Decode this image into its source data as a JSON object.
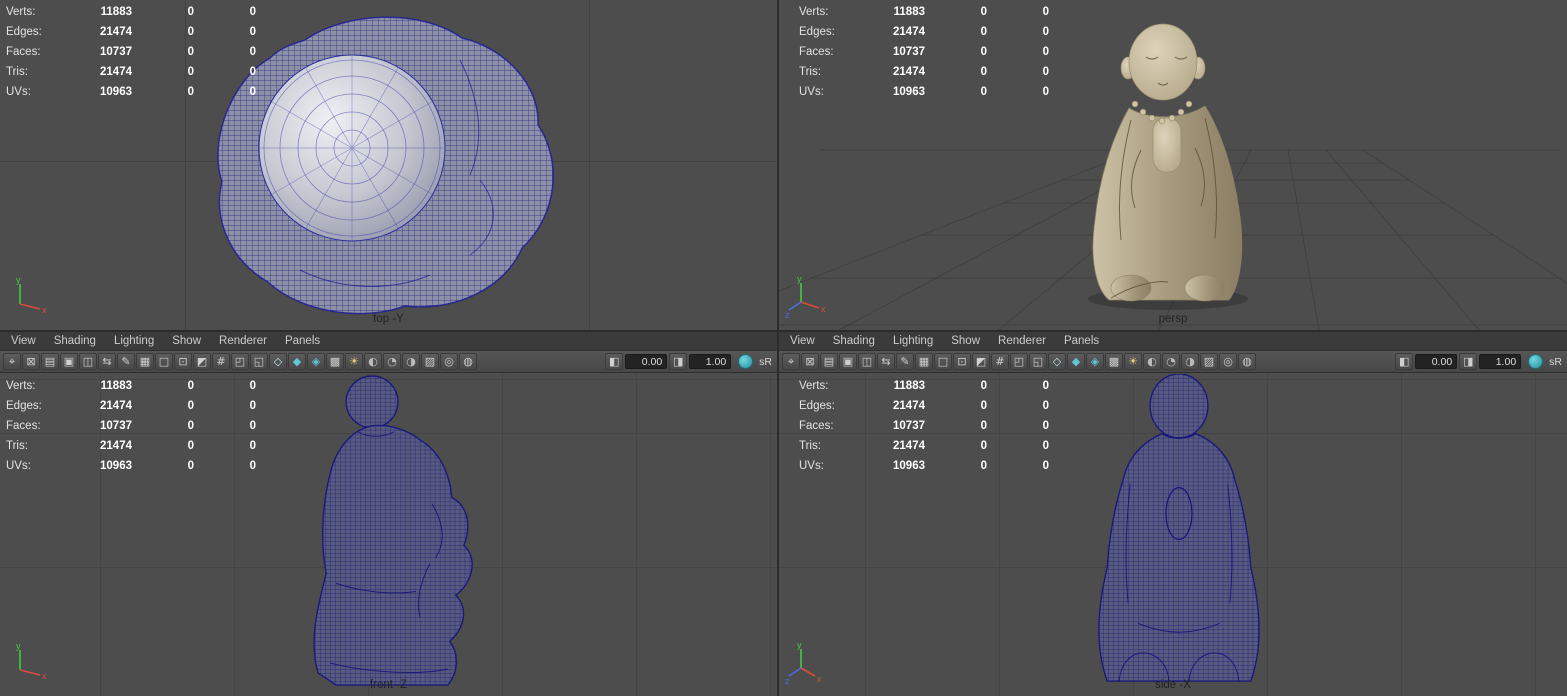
{
  "stats": {
    "rows": [
      {
        "label": "Verts:",
        "v1": "11883",
        "v2": "0",
        "v3": "0"
      },
      {
        "label": "Edges:",
        "v1": "21474",
        "v2": "0",
        "v3": "0"
      },
      {
        "label": "Faces:",
        "v1": "10737",
        "v2": "0",
        "v3": "0"
      },
      {
        "label": "Tris:",
        "v1": "21474",
        "v2": "0",
        "v3": "0"
      },
      {
        "label": "UVs:",
        "v1": "10963",
        "v2": "0",
        "v3": "0"
      }
    ]
  },
  "menus": [
    {
      "name": "menu-view",
      "label": "View"
    },
    {
      "name": "menu-shading",
      "label": "Shading"
    },
    {
      "name": "menu-lighting",
      "label": "Lighting"
    },
    {
      "name": "menu-show",
      "label": "Show"
    },
    {
      "name": "menu-renderer",
      "label": "Renderer"
    },
    {
      "name": "menu-panels",
      "label": "Panels"
    }
  ],
  "toolbar": {
    "icons": [
      {
        "name": "select-camera-icon",
        "glyph": "⌖",
        "color": "#d4d4d4"
      },
      {
        "name": "lock-camera-icon",
        "glyph": "⊠",
        "color": "#cfcfcf"
      },
      {
        "name": "camera-attributes-icon",
        "glyph": "▤",
        "color": "#cfcfcf"
      },
      {
        "name": "bookmarks-icon",
        "glyph": "▣",
        "color": "#cfcfcf"
      },
      {
        "name": "image-plane-icon",
        "glyph": "◫",
        "color": "#cfcfcf"
      },
      {
        "name": "pan-zoom-icon",
        "glyph": "⇆",
        "color": "#cfcfcf"
      },
      {
        "name": "grease-pencil-icon",
        "glyph": "✎",
        "color": "#cfcfcf"
      },
      {
        "name": "grid-icon",
        "glyph": "▦",
        "color": "#cfcfcf"
      },
      {
        "name": "film-gate-icon",
        "glyph": "□",
        "color": "#cfcfcf"
      },
      {
        "name": "resolution-gate-icon",
        "glyph": "⊡",
        "color": "#cfcfcf"
      },
      {
        "name": "gate-mask-icon",
        "glyph": "◩",
        "color": "#cfcfcf"
      },
      {
        "name": "field-chart-icon",
        "glyph": "#",
        "color": "#cfcfcf"
      },
      {
        "name": "safe-action-icon",
        "glyph": "◰",
        "color": "#cfcfcf"
      },
      {
        "name": "safe-title-icon",
        "glyph": "◱",
        "color": "#cfcfcf"
      },
      {
        "name": "wireframe-mode-icon",
        "glyph": "◇",
        "color": "#bfe3ee"
      },
      {
        "name": "shaded-mode-icon",
        "glyph": "◆",
        "color": "#5fc6d4"
      },
      {
        "name": "textured-mode-icon",
        "glyph": "◈",
        "color": "#5fc6d4"
      },
      {
        "name": "checker-icon",
        "glyph": "▩",
        "color": "#cfcfcf"
      },
      {
        "name": "use-all-lights-icon",
        "glyph": "☀",
        "color": "#e9cf7a"
      },
      {
        "name": "shadows-icon",
        "glyph": "◐",
        "color": "#bbbbbb"
      },
      {
        "name": "occlusion-icon",
        "glyph": "◔",
        "color": "#bbbbbb"
      },
      {
        "name": "motion-blur-icon",
        "glyph": "◑",
        "color": "#bbbbbb"
      },
      {
        "name": "multisample-icon",
        "glyph": "▨",
        "color": "#cfcfcf"
      },
      {
        "name": "isolate-select-icon",
        "glyph": "◎",
        "color": "#cfcfcf"
      },
      {
        "name": "xray-icon",
        "glyph": "◍",
        "color": "#cfcfcf"
      }
    ],
    "exposure_icon": "◧",
    "exposure_value": "0.00",
    "gamma_icon": "◨",
    "gamma_value": "1.00",
    "view_transform_label": "sR"
  },
  "viewports": {
    "top": {
      "label": "top -Y"
    },
    "persp": {
      "label": "persp"
    },
    "front": {
      "label": "front -Z"
    },
    "side": {
      "label": "side -X"
    }
  },
  "axis": {
    "x": "x",
    "y": "y",
    "z": "z"
  },
  "colors": {
    "wireframe": "#1c1c96",
    "viewport_background": "#4d4d4d",
    "axis_x": "#d94c3a",
    "axis_y": "#44c944",
    "axis_z": "#4a6fe0",
    "color_management_accent": "#3fb0c0"
  }
}
